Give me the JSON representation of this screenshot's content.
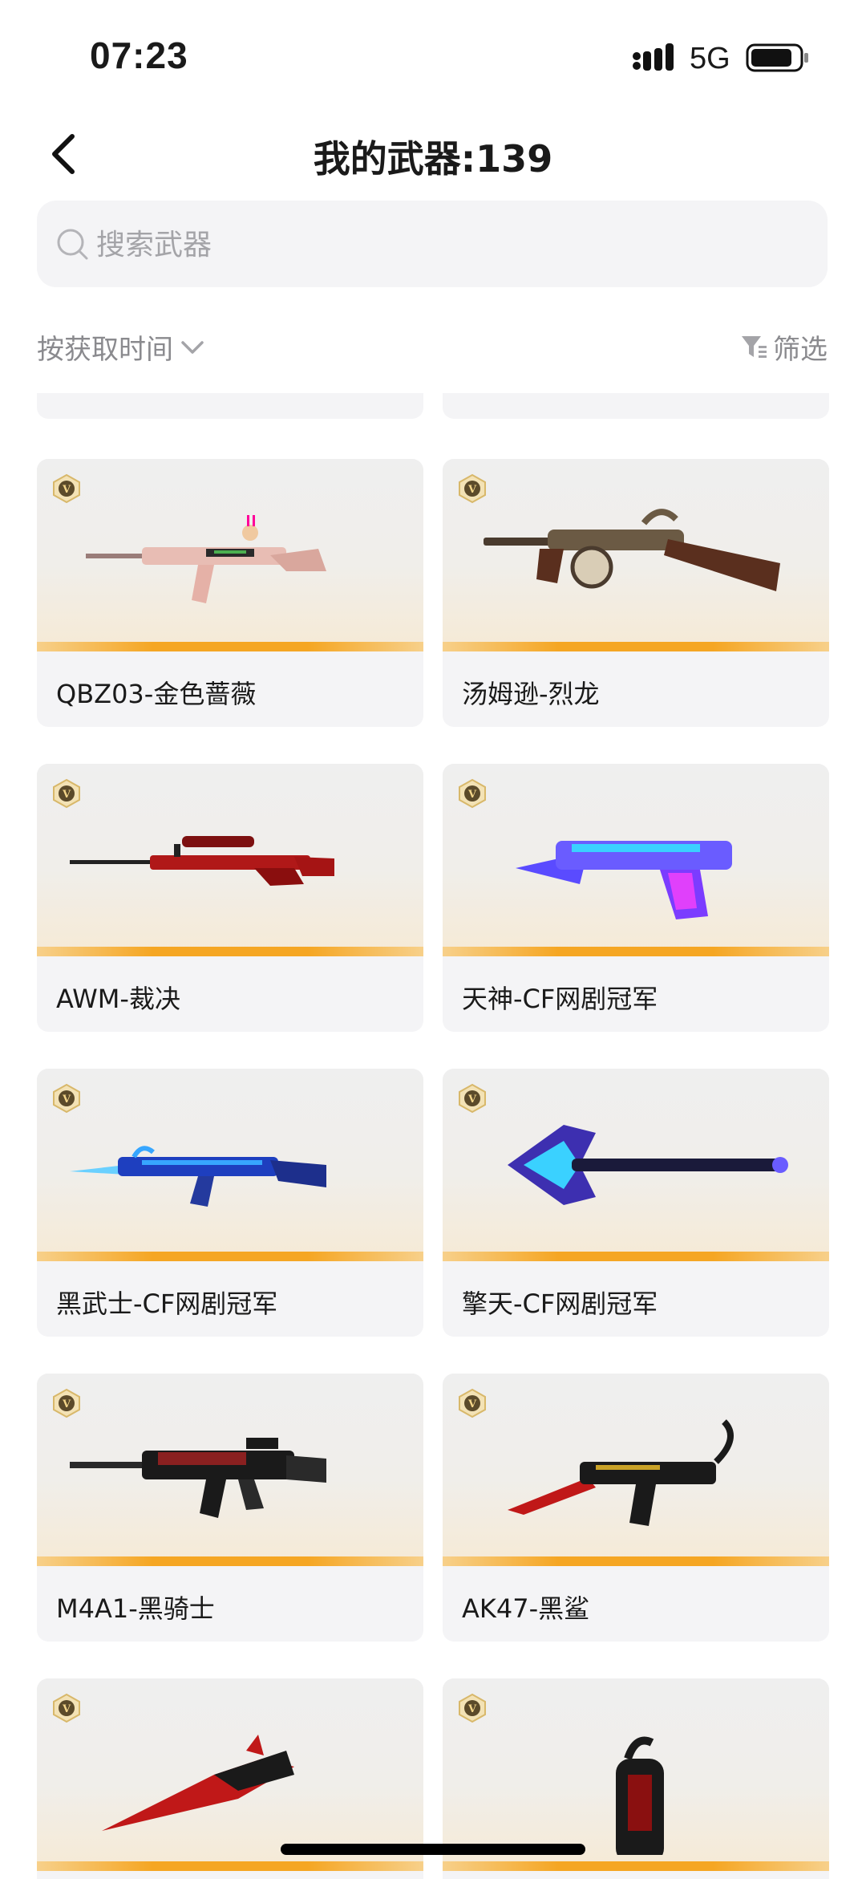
{
  "status_bar": {
    "time": "07:23",
    "network": "5G"
  },
  "header": {
    "title": "我的武器:139"
  },
  "search": {
    "placeholder": "搜索武器",
    "value": ""
  },
  "toolbar": {
    "sort_label": "按获取时间",
    "filter_label": "筛选"
  },
  "weapons": [
    {
      "name": "QBZ03-金色蔷薇",
      "art": "rifle-pink",
      "badge": "V"
    },
    {
      "name": "汤姆逊-烈龙",
      "art": "tommy-gun",
      "badge": "V"
    },
    {
      "name": "AWM-裁决",
      "art": "sniper-red",
      "badge": "V"
    },
    {
      "name": "天神-CF网剧冠军",
      "art": "pistol-blue",
      "badge": "V"
    },
    {
      "name": "黑武士-CF网剧冠军",
      "art": "rifle-blue",
      "badge": "V"
    },
    {
      "name": "擎天-CF网剧冠军",
      "art": "axe-blue",
      "badge": "V"
    },
    {
      "name": "M4A1-黑骑士",
      "art": "m4-dark",
      "badge": "V"
    },
    {
      "name": "AK47-黑鲨",
      "art": "ak-dark",
      "badge": "V"
    },
    {
      "name": "",
      "art": "blade-red",
      "badge": "V"
    },
    {
      "name": "",
      "art": "grenade-dark",
      "badge": "V"
    }
  ],
  "colors": {
    "accent": "#F5A623",
    "card_bg": "#F4F4F6",
    "muted_text": "#8A8A8E"
  }
}
